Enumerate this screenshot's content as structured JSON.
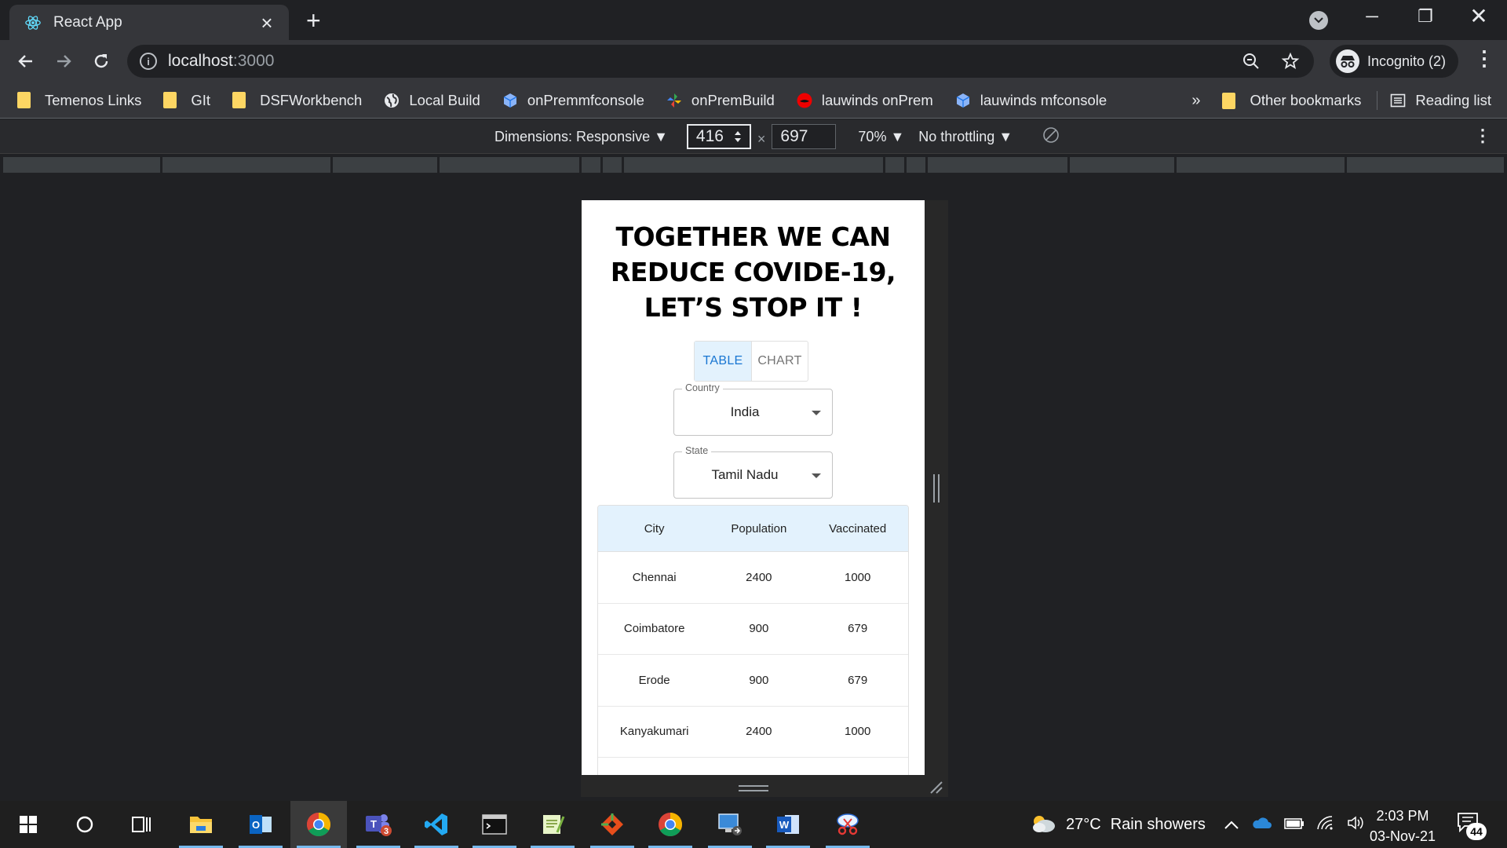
{
  "browser": {
    "tab_title": "React App",
    "url_host": "localhost",
    "url_port": ":3000",
    "profile_label": "Incognito (2)"
  },
  "bookmarks": {
    "items": [
      {
        "label": "Temenos Links",
        "icon": "folder-icon"
      },
      {
        "label": "GIt",
        "icon": "folder-icon"
      },
      {
        "label": "DSFWorkbench",
        "icon": "folder-icon"
      },
      {
        "label": "Local Build",
        "icon": "globe-icon"
      },
      {
        "label": "onPremmfconsole",
        "icon": "cube-icon"
      },
      {
        "label": "onPremBuild",
        "icon": "pinwheel-icon"
      },
      {
        "label": "lauwinds onPrem",
        "icon": "redhat-icon"
      },
      {
        "label": "lauwinds mfconsole",
        "icon": "cube-icon"
      }
    ],
    "overflow": "»",
    "other": "Other bookmarks",
    "reading_list": "Reading list"
  },
  "devtools": {
    "dimensions": "Dimensions: Responsive ▼",
    "width": "416",
    "height": "697",
    "times": "×",
    "zoom": "70% ▼",
    "throttling": "No throttling ▼"
  },
  "app": {
    "headline": "TOGETHER WE CAN REDUCE COVIDE-19, LET’S STOP IT !",
    "toggle": {
      "table": "TABLE",
      "chart": "CHART",
      "selected": "TABLE"
    },
    "country": {
      "label": "Country",
      "value": "India"
    },
    "state": {
      "label": "State",
      "value": "Tamil Nadu"
    },
    "table": {
      "headers": [
        "City",
        "Population",
        "Vaccinated"
      ],
      "rows": [
        [
          "Chennai",
          "2400",
          "1000"
        ],
        [
          "Coimbatore",
          "900",
          "679"
        ],
        [
          "Erode",
          "900",
          "679"
        ],
        [
          "Kanyakumari",
          "2400",
          "1000"
        ]
      ]
    }
  },
  "taskbar": {
    "weather_temp": "27°C",
    "weather_text": "Rain showers",
    "time": "2:03 PM",
    "date": "03-Nov-21",
    "notifications": "44",
    "teams_badge": "3"
  },
  "colors": {
    "accent_blue": "#1976d2",
    "header_bg": "#e3f2fd",
    "folder_yellow": "#fdd663",
    "browser_dark": "#202124"
  }
}
